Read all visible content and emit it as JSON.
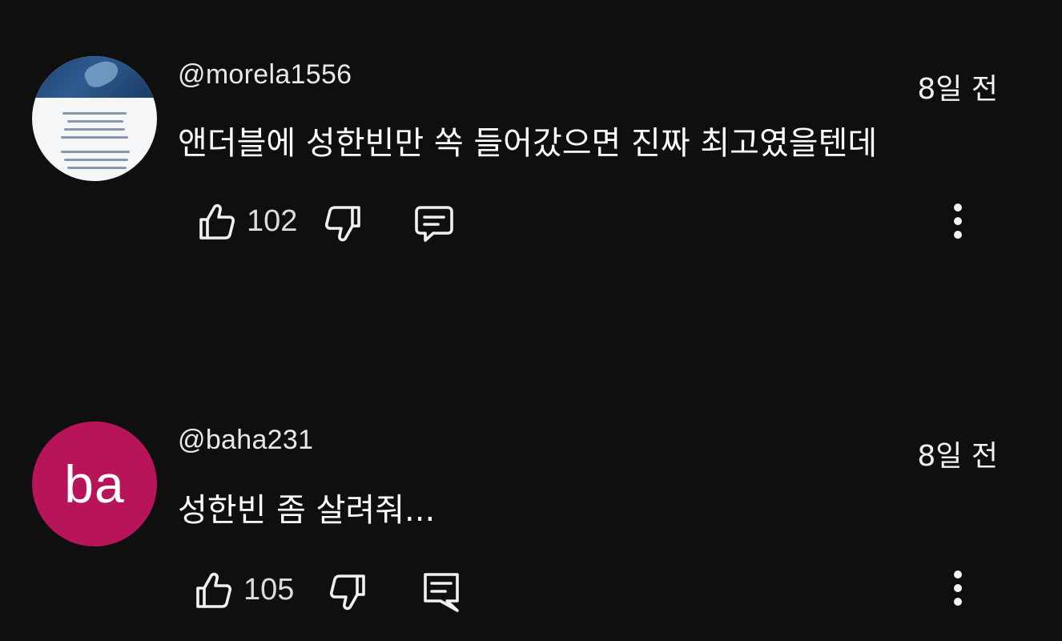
{
  "comments": [
    {
      "handle": "@morela1556",
      "time": "8일 전",
      "text": "앤더블에 성한빈만 쏙 들어갔으면 진짜 최고였을텐데",
      "like_count": "102",
      "avatar_type": "photo",
      "icons": [
        "thumbs-up-icon",
        "thumbs-down-icon",
        "reply-icon",
        "more-vert-icon"
      ]
    },
    {
      "handle": "@baha231",
      "time": "8일 전",
      "text": "성한빈 좀 살려줘...",
      "like_count": "105",
      "avatar_type": "letters",
      "avatar_letters": "ba",
      "avatar_color": "#b8145a",
      "icons": [
        "thumbs-up-icon",
        "thumbs-down-icon",
        "reply-icon",
        "more-vert-icon"
      ]
    }
  ],
  "theme": {
    "background": "#0f0f0f",
    "text": "#f1f1f1"
  }
}
